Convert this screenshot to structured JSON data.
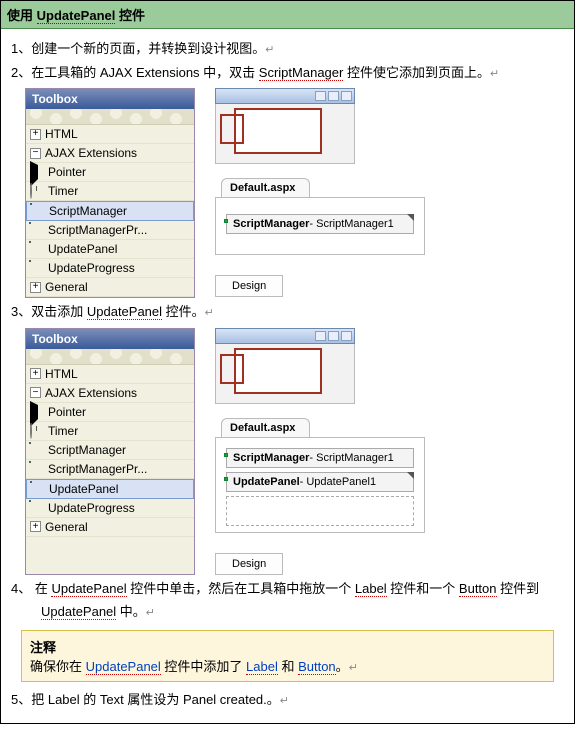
{
  "header": {
    "cn": "使用 ",
    "en": "UpdatePanel",
    "cn2": " 控件"
  },
  "step1": {
    "num": "1、",
    "text": "创建一个新的页面，并转换到设计视图。",
    "ret": "↵"
  },
  "step2": {
    "num": "2、",
    "t1": "在工具箱的 AJAX Extensions 中，双击 ",
    "sm": "ScriptManager",
    "t2": " 控件使它添加到页面上。",
    "ret": "↵"
  },
  "toolbox1": {
    "title": "Toolbox",
    "html": "HTML",
    "ajax": "AJAX Extensions",
    "pointer": "Pointer",
    "timer": "Timer",
    "sm": "ScriptManager",
    "smp": "ScriptManagerPr...",
    "up": "UpdatePanel",
    "upp": "UpdateProgress",
    "general": "General"
  },
  "design1": {
    "tab": "Default.aspx",
    "bar": {
      "bold": "ScriptManager",
      "rest": " - ScriptManager1"
    },
    "btn": "Design"
  },
  "step3": {
    "num": "3、",
    "t1": "双击添加 ",
    "up": "UpdatePanel",
    "t2": " 控件。",
    "ret": "↵"
  },
  "toolbox2": {
    "title": "Toolbox",
    "html": "HTML",
    "ajax": "AJAX Extensions",
    "pointer": "Pointer",
    "timer": "Timer",
    "sm": "ScriptManager",
    "smp": "ScriptManagerPr...",
    "up": "UpdatePanel",
    "upp": "UpdateProgress",
    "general": "General"
  },
  "design2": {
    "tab": "Default.aspx",
    "bar1": {
      "bold": "ScriptManager",
      "rest": " - ScriptManager1"
    },
    "bar2": {
      "bold": "UpdatePanel",
      "rest": " - UpdatePanel1"
    },
    "btn": "Design"
  },
  "step4": {
    "num": "4、",
    "t1": " 在 ",
    "up": "UpdatePanel",
    "t2": " 控件中单击，然后在工具箱中拖放一个 ",
    "label": "Label",
    "t3": " 控件和一个 ",
    "button": "Button",
    "t4": " 控件到",
    "line2a": "",
    "up2": "UpdatePanel",
    "t5": " 中。",
    "ret": "↵"
  },
  "note": {
    "title": "注释",
    "t1": "确保你在 ",
    "up": "UpdatePanel",
    "t2": " 控件中添加了 ",
    "label": "Label",
    "t3": " 和 ",
    "button": "Button",
    "t4": "。",
    "ret": "↵"
  },
  "step5": {
    "num": "5、",
    "t1": "把 Label 的 Text 属性设为 Panel created.。",
    "ret": "↵"
  }
}
